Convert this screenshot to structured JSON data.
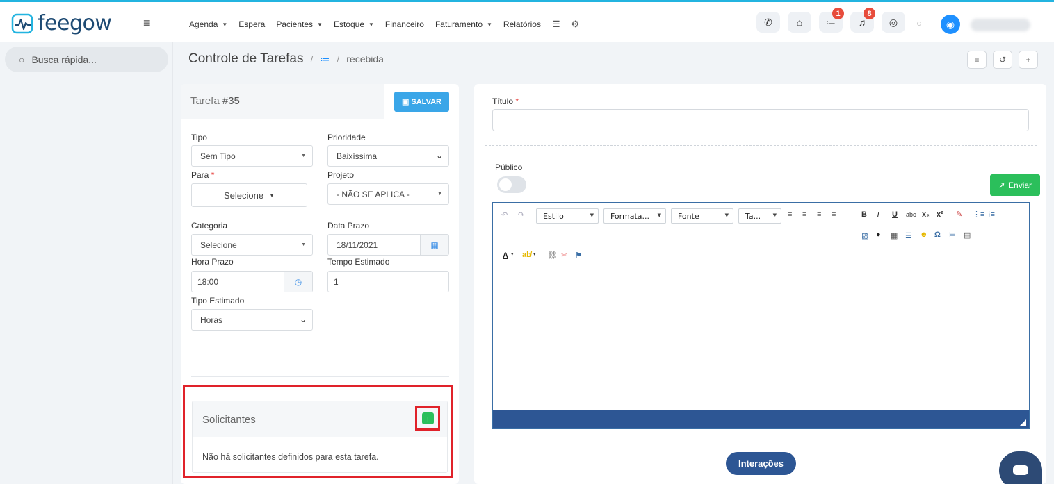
{
  "app": {
    "logo_text": "feegow"
  },
  "nav": [
    {
      "label": "Agenda",
      "dropdown": true
    },
    {
      "label": "Espera",
      "dropdown": false
    },
    {
      "label": "Pacientes",
      "dropdown": true
    },
    {
      "label": "Estoque",
      "dropdown": true
    },
    {
      "label": "Financeiro",
      "dropdown": false
    },
    {
      "label": "Faturamento",
      "dropdown": true
    },
    {
      "label": "Relatórios",
      "dropdown": false
    }
  ],
  "nav_icons": [
    "database-icon",
    "gear-icon"
  ],
  "header_icons": [
    {
      "name": "phone-icon",
      "badge": ""
    },
    {
      "name": "inbox-icon",
      "badge": ""
    },
    {
      "name": "task-list-icon",
      "badge": "1"
    },
    {
      "name": "bell-icon",
      "badge": "8"
    },
    {
      "name": "chat-icon",
      "badge": ""
    }
  ],
  "search": {
    "placeholder": "Busca rápida..."
  },
  "breadcrumb": {
    "title": "Controle de Tarefas",
    "separator": "/",
    "current": "recebida"
  },
  "task": {
    "label": "Tarefa",
    "number": "#35",
    "save_label": "SALVAR"
  },
  "form": {
    "tipo": {
      "label": "Tipo",
      "value": "Sem Tipo"
    },
    "prioridade": {
      "label": "Prioridade",
      "value": "Baixíssima"
    },
    "para": {
      "label": "Para",
      "value": "Selecione"
    },
    "projeto": {
      "label": "Projeto",
      "value": "- NÃO SE APLICA -"
    },
    "categoria": {
      "label": "Categoria",
      "value": "Selecione"
    },
    "data_prazo": {
      "label": "Data Prazo",
      "value": "18/11/2021"
    },
    "hora_prazo": {
      "label": "Hora Prazo",
      "value": "18:00"
    },
    "tempo_estimado": {
      "label": "Tempo Estimado",
      "value": "1"
    },
    "tipo_estimado": {
      "label": "Tipo Estimado",
      "value": "Horas"
    }
  },
  "required_mark": "*",
  "solicitantes": {
    "title": "Solicitantes",
    "add_label": "+",
    "empty_text": "Não há solicitantes definidos para esta tarefa."
  },
  "right": {
    "titulo_label": "Título",
    "publico_label": "Público",
    "publico_on": false,
    "send_label": "Enviar",
    "interacoes_label": "Interações"
  },
  "editor": {
    "combos": [
      "Estilo",
      "Formata...",
      "Fonte",
      "Ta..."
    ]
  },
  "colors": {
    "accent": "#2d5694",
    "green": "#2bbf5b",
    "blue": "#3aa6e8",
    "badge": "#e74c3c"
  }
}
